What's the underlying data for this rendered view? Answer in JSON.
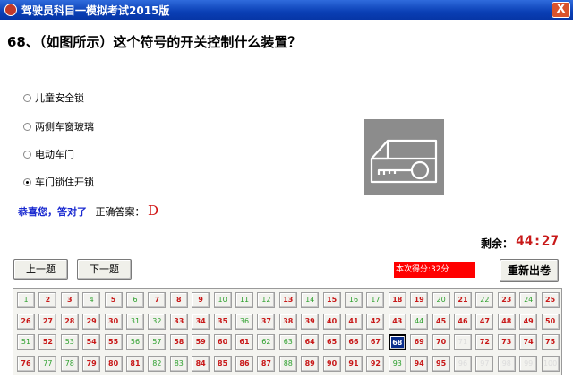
{
  "window": {
    "title": "驾驶员科目一模拟考试2015版",
    "close_label": "X"
  },
  "question": {
    "text": "68、（如图所示）这个符号的开关控制什么装置？"
  },
  "options": [
    {
      "label": "儿童安全锁",
      "selected": false
    },
    {
      "label": "两侧车窗玻璃",
      "selected": false
    },
    {
      "label": "电动车门",
      "selected": false
    },
    {
      "label": "车门锁住开锁",
      "selected": true
    }
  ],
  "result": {
    "message": "恭喜您，答对了",
    "answer_label": "正确答案：",
    "answer_value": "D"
  },
  "timer": {
    "label": "剩余：",
    "value": "44:27"
  },
  "buttons": {
    "prev": "上一题",
    "next": "下一题",
    "restart": "重新出卷"
  },
  "score": {
    "text": "本次得分:32分"
  },
  "colors": {
    "title_bar": "#0a3fb5",
    "score_bg": "#ff0000",
    "timer": "#c81818",
    "correct": "#2ea02e",
    "wrong": "#c81818",
    "current": "#0a2e8c"
  },
  "icons": {
    "sign": "door-lock-key-icon",
    "app": "app-logo-icon",
    "close": "close-icon"
  },
  "grid": {
    "current": 68,
    "cells": [
      {
        "n": 1,
        "s": "ok"
      },
      {
        "n": 2,
        "s": "wrong"
      },
      {
        "n": 3,
        "s": "wrong"
      },
      {
        "n": 4,
        "s": "ok"
      },
      {
        "n": 5,
        "s": "wrong"
      },
      {
        "n": 6,
        "s": "ok"
      },
      {
        "n": 7,
        "s": "wrong"
      },
      {
        "n": 8,
        "s": "wrong"
      },
      {
        "n": 9,
        "s": "wrong"
      },
      {
        "n": 10,
        "s": "ok"
      },
      {
        "n": 11,
        "s": "ok"
      },
      {
        "n": 12,
        "s": "ok"
      },
      {
        "n": 13,
        "s": "wrong"
      },
      {
        "n": 14,
        "s": "ok"
      },
      {
        "n": 15,
        "s": "wrong"
      },
      {
        "n": 16,
        "s": "ok"
      },
      {
        "n": 17,
        "s": "ok"
      },
      {
        "n": 18,
        "s": "wrong"
      },
      {
        "n": 19,
        "s": "wrong"
      },
      {
        "n": 20,
        "s": "ok"
      },
      {
        "n": 21,
        "s": "wrong"
      },
      {
        "n": 22,
        "s": "ok"
      },
      {
        "n": 23,
        "s": "wrong"
      },
      {
        "n": 24,
        "s": "ok"
      },
      {
        "n": 25,
        "s": "wrong"
      },
      {
        "n": 26,
        "s": "wrong"
      },
      {
        "n": 27,
        "s": "wrong"
      },
      {
        "n": 28,
        "s": "wrong"
      },
      {
        "n": 29,
        "s": "wrong"
      },
      {
        "n": 30,
        "s": "wrong"
      },
      {
        "n": 31,
        "s": "ok"
      },
      {
        "n": 32,
        "s": "ok"
      },
      {
        "n": 33,
        "s": "wrong"
      },
      {
        "n": 34,
        "s": "wrong"
      },
      {
        "n": 35,
        "s": "wrong"
      },
      {
        "n": 36,
        "s": "ok"
      },
      {
        "n": 37,
        "s": "wrong"
      },
      {
        "n": 38,
        "s": "wrong"
      },
      {
        "n": 39,
        "s": "wrong"
      },
      {
        "n": 40,
        "s": "wrong"
      },
      {
        "n": 41,
        "s": "wrong"
      },
      {
        "n": 42,
        "s": "wrong"
      },
      {
        "n": 43,
        "s": "wrong"
      },
      {
        "n": 44,
        "s": "ok"
      },
      {
        "n": 45,
        "s": "wrong"
      },
      {
        "n": 46,
        "s": "wrong"
      },
      {
        "n": 47,
        "s": "wrong"
      },
      {
        "n": 48,
        "s": "wrong"
      },
      {
        "n": 49,
        "s": "wrong"
      },
      {
        "n": 50,
        "s": "wrong"
      },
      {
        "n": 51,
        "s": "ok"
      },
      {
        "n": 52,
        "s": "wrong"
      },
      {
        "n": 53,
        "s": "ok"
      },
      {
        "n": 54,
        "s": "wrong"
      },
      {
        "n": 55,
        "s": "wrong"
      },
      {
        "n": 56,
        "s": "ok"
      },
      {
        "n": 57,
        "s": "ok"
      },
      {
        "n": 58,
        "s": "wrong"
      },
      {
        "n": 59,
        "s": "wrong"
      },
      {
        "n": 60,
        "s": "wrong"
      },
      {
        "n": 61,
        "s": "wrong"
      },
      {
        "n": 62,
        "s": "ok"
      },
      {
        "n": 63,
        "s": "ok"
      },
      {
        "n": 64,
        "s": "wrong"
      },
      {
        "n": 65,
        "s": "wrong"
      },
      {
        "n": 66,
        "s": "wrong"
      },
      {
        "n": 67,
        "s": "wrong"
      },
      {
        "n": 68,
        "s": "current"
      },
      {
        "n": 69,
        "s": "wrong"
      },
      {
        "n": 70,
        "s": "wrong"
      },
      {
        "n": 71,
        "s": "faded"
      },
      {
        "n": 72,
        "s": "wrong"
      },
      {
        "n": 73,
        "s": "wrong"
      },
      {
        "n": 74,
        "s": "wrong"
      },
      {
        "n": 75,
        "s": "wrong"
      },
      {
        "n": 76,
        "s": "wrong"
      },
      {
        "n": 77,
        "s": "ok"
      },
      {
        "n": 78,
        "s": "ok"
      },
      {
        "n": 79,
        "s": "wrong"
      },
      {
        "n": 80,
        "s": "wrong"
      },
      {
        "n": 81,
        "s": "wrong"
      },
      {
        "n": 82,
        "s": "ok"
      },
      {
        "n": 83,
        "s": "ok"
      },
      {
        "n": 84,
        "s": "wrong"
      },
      {
        "n": 85,
        "s": "wrong"
      },
      {
        "n": 86,
        "s": "wrong"
      },
      {
        "n": 87,
        "s": "wrong"
      },
      {
        "n": 88,
        "s": "ok"
      },
      {
        "n": 89,
        "s": "wrong"
      },
      {
        "n": 90,
        "s": "wrong"
      },
      {
        "n": 91,
        "s": "wrong"
      },
      {
        "n": 92,
        "s": "wrong"
      },
      {
        "n": 93,
        "s": "ok"
      },
      {
        "n": 94,
        "s": "wrong"
      },
      {
        "n": 95,
        "s": "wrong"
      },
      {
        "n": 96,
        "s": "faded"
      },
      {
        "n": 97,
        "s": "faded"
      },
      {
        "n": 98,
        "s": "faded"
      },
      {
        "n": 99,
        "s": "faded"
      },
      {
        "n": 100,
        "s": "faded"
      }
    ]
  }
}
